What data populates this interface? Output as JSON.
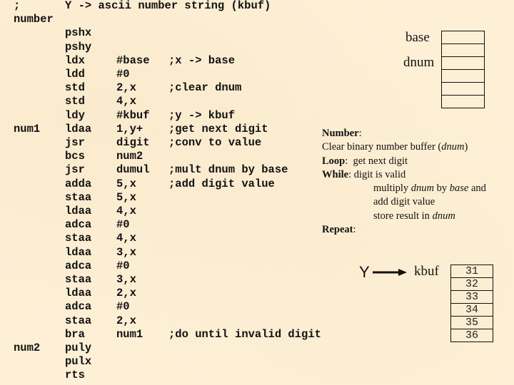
{
  "code": [
    {
      "label": ";",
      "op": "Y -> ascii number string (kbuf)",
      "arg": "",
      "comment": ""
    },
    {
      "label": "number",
      "op": "",
      "arg": "",
      "comment": ""
    },
    {
      "label": "",
      "op": "pshx",
      "arg": "",
      "comment": ""
    },
    {
      "label": "",
      "op": "pshy",
      "arg": "",
      "comment": ""
    },
    {
      "label": "",
      "op": "ldx",
      "arg": "#base",
      "comment": ";x -> base"
    },
    {
      "label": "",
      "op": "ldd",
      "arg": "#0",
      "comment": ""
    },
    {
      "label": "",
      "op": "std",
      "arg": "2,x",
      "comment": ";clear dnum"
    },
    {
      "label": "",
      "op": "std",
      "arg": "4,x",
      "comment": ""
    },
    {
      "label": "",
      "op": "ldy",
      "arg": "#kbuf",
      "comment": ";y -> kbuf"
    },
    {
      "label": "num1",
      "op": "ldaa",
      "arg": "1,y+",
      "comment": ";get next digit"
    },
    {
      "label": "",
      "op": "jsr",
      "arg": "digit",
      "comment": ";conv to value"
    },
    {
      "label": "",
      "op": "bcs",
      "arg": "num2",
      "comment": ""
    },
    {
      "label": "",
      "op": "jsr",
      "arg": "dumul",
      "comment": ";mult dnum by base"
    },
    {
      "label": "",
      "op": "adda",
      "arg": "5,x",
      "comment": ";add digit value"
    },
    {
      "label": "",
      "op": "staa",
      "arg": "5,x",
      "comment": ""
    },
    {
      "label": "",
      "op": "ldaa",
      "arg": "4,x",
      "comment": ""
    },
    {
      "label": "",
      "op": "adca",
      "arg": "#0",
      "comment": ""
    },
    {
      "label": "",
      "op": "staa",
      "arg": "4,x",
      "comment": ""
    },
    {
      "label": "",
      "op": "ldaa",
      "arg": "3,x",
      "comment": ""
    },
    {
      "label": "",
      "op": "adca",
      "arg": "#0",
      "comment": ""
    },
    {
      "label": "",
      "op": "staa",
      "arg": "3,x",
      "comment": ""
    },
    {
      "label": "",
      "op": "ldaa",
      "arg": "2,x",
      "comment": ""
    },
    {
      "label": "",
      "op": "adca",
      "arg": "#0",
      "comment": ""
    },
    {
      "label": "",
      "op": "staa",
      "arg": "2,x",
      "comment": ""
    },
    {
      "label": "",
      "op": "bra",
      "arg": "num1",
      "comment": ";do until invalid digit"
    },
    {
      "label": "num2",
      "op": "puly",
      "arg": "",
      "comment": ""
    },
    {
      "label": "",
      "op": "pulx",
      "arg": "",
      "comment": ""
    },
    {
      "label": "",
      "op": "rts",
      "arg": "",
      "comment": ""
    }
  ],
  "memory": {
    "base_label": "base",
    "dnum_label": "dnum",
    "cells": [
      "",
      "",
      "",
      "",
      "",
      ""
    ]
  },
  "description": {
    "title": "Number",
    "clear_text": "Clear binary number buffer (",
    "clear_var": "dnum",
    "loop_kw": "Loop",
    "loop_text": "get next digit",
    "while_kw": "While",
    "while_text": "digit is valid",
    "mult_a": "multiply ",
    "mult_var1": "dnum",
    "mult_b": " by ",
    "mult_var2": "base",
    "mult_c": " and",
    "add_text": "add digit value",
    "store_text": "store result in ",
    "store_var": "dnum",
    "repeat_kw": "Repeat"
  },
  "kbuf": {
    "pointer_label": "Y",
    "label": "kbuf",
    "cells": [
      "31",
      "32",
      "33",
      "34",
      "35",
      "36"
    ]
  }
}
